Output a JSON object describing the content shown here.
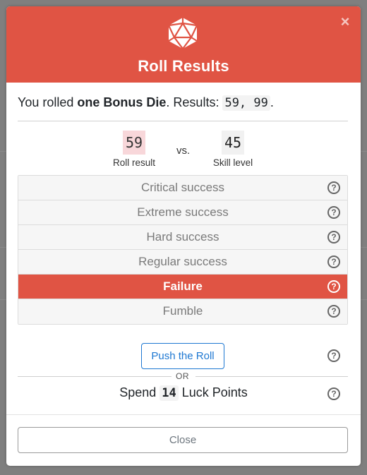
{
  "dialog": {
    "title": "Roll Results",
    "close_glyph": "×",
    "icon": "d20-die-icon",
    "accent_color": "#e05444"
  },
  "intro": {
    "prefix": "You rolled ",
    "bonus": "one Bonus Die",
    "middle": ". Results: ",
    "results": "59, 99",
    "suffix": "."
  },
  "comparison": {
    "roll_value": "59",
    "roll_label": "Roll result",
    "vs": "vs.",
    "skill_value": "45",
    "skill_label": "Skill level"
  },
  "outcomes": [
    {
      "label": "Critical success",
      "active": false
    },
    {
      "label": "Extreme success",
      "active": false
    },
    {
      "label": "Hard success",
      "active": false
    },
    {
      "label": "Regular success",
      "active": false
    },
    {
      "label": "Failure",
      "active": true
    },
    {
      "label": "Fumble",
      "active": false
    }
  ],
  "actions": {
    "push_label": "Push the Roll",
    "or_label": "OR",
    "spend_prefix": "Spend ",
    "spend_points": "14",
    "spend_suffix": " Luck Points",
    "close_label": "Close",
    "help_glyph": "?"
  }
}
